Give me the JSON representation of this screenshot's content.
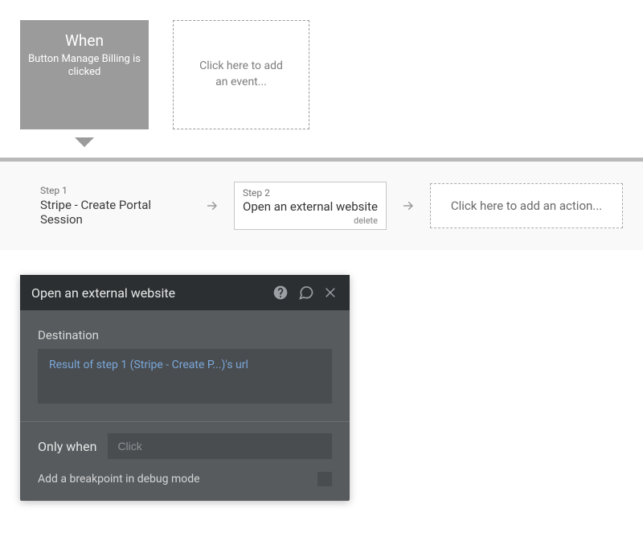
{
  "events": {
    "selected": {
      "title": "When",
      "subtitle": "Button Manage Billing is clicked"
    },
    "add_placeholder": "Click here to add an event..."
  },
  "steps": {
    "step1": {
      "num": "Step 1",
      "title": "Stripe - Create Portal Session"
    },
    "step2": {
      "num": "Step 2",
      "title": "Open an external website",
      "delete": "delete"
    },
    "add_placeholder": "Click here to add an action..."
  },
  "panel": {
    "title": "Open an external website",
    "destination_label": "Destination",
    "destination_expr": "Result of step 1 (Stripe - Create P...)'s url",
    "only_when_label": "Only when",
    "only_when_placeholder": "Click",
    "breakpoint_label": "Add a breakpoint in debug mode"
  }
}
